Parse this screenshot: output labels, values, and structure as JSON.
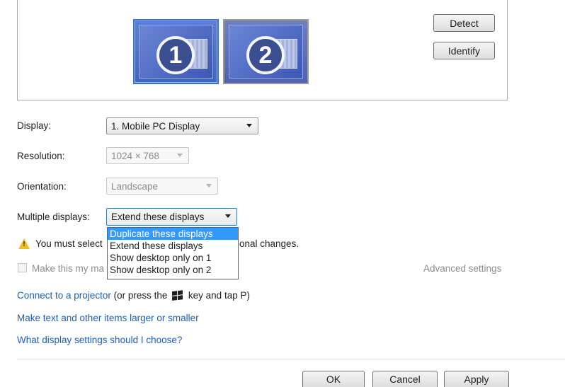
{
  "preview": {
    "monitors": [
      {
        "number": "1",
        "selected": true
      },
      {
        "number": "2",
        "selected": false
      }
    ],
    "detect_label": "Detect",
    "identify_label": "Identify"
  },
  "settings": {
    "display_label": "Display:",
    "display_value": "1. Mobile PC Display",
    "resolution_label": "Resolution:",
    "resolution_value": "1024 × 768",
    "orientation_label": "Orientation:",
    "orientation_value": "Landscape",
    "multiple_label": "Multiple displays:",
    "multiple_value": "Extend these displays",
    "multiple_options": [
      "Duplicate these displays",
      "Extend these displays",
      "Show desktop only on 1",
      "Show desktop only on 2"
    ],
    "multiple_highlighted_option": "Duplicate these displays"
  },
  "warning": {
    "icon": "warning-icon",
    "text_left": "You must select",
    "text_right": "onal changes."
  },
  "checkbox": {
    "label": "Make this my ma",
    "checked": false
  },
  "advanced_settings_label": "Advanced settings",
  "links": {
    "connect_projector": "Connect to a projector",
    "connect_projector_hint_pre": "(or press the",
    "connect_projector_hint_post": "key and tap P)",
    "larger_smaller": "Make text and other items larger or smaller",
    "which_settings": "What display settings should I choose?"
  },
  "footer": {
    "ok_label": "OK",
    "cancel_label": "Cancel",
    "apply_label": "Apply"
  },
  "colors": {
    "link": "#1c5fb5",
    "selection": "#3399ff",
    "warning": "#f2c01e"
  }
}
